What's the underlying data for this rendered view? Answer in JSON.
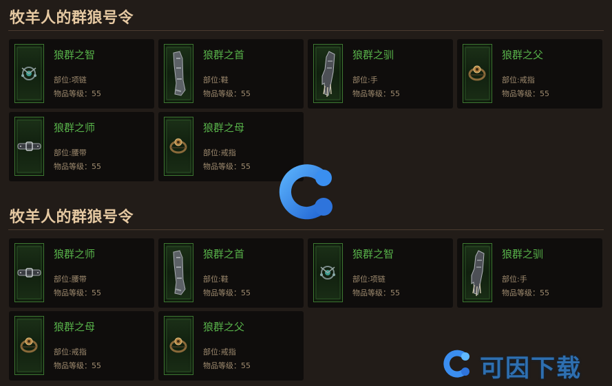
{
  "sections": [
    {
      "title": "牧羊人的群狼号令",
      "items": [
        {
          "name": "狼群之智",
          "slot": "部位:项链",
          "level": "物品等级：55",
          "icon": "amulet-icon"
        },
        {
          "name": "狼群之首",
          "slot": "部位:鞋",
          "level": "物品等级：55",
          "icon": "boots-icon"
        },
        {
          "name": "狼群之驯",
          "slot": "部位:手",
          "level": "物品等级：55",
          "icon": "gloves-icon"
        },
        {
          "name": "狼群之父",
          "slot": "部位:戒指",
          "level": "物品等级：55",
          "icon": "ring-icon"
        },
        {
          "name": "狼群之师",
          "slot": "部位:腰带",
          "level": "物品等级：55",
          "icon": "belt-icon"
        },
        {
          "name": "狼群之母",
          "slot": "部位:戒指",
          "level": "物品等级：55",
          "icon": "ring-icon"
        }
      ]
    },
    {
      "title": "牧羊人的群狼号令",
      "items": [
        {
          "name": "狼群之师",
          "slot": "部位:腰带",
          "level": "物品等级：55",
          "icon": "belt-icon"
        },
        {
          "name": "狼群之首",
          "slot": "部位:鞋",
          "level": "物品等级：55",
          "icon": "boots-icon"
        },
        {
          "name": "狼群之智",
          "slot": "部位:项链",
          "level": "物品等级：55",
          "icon": "amulet-icon"
        },
        {
          "name": "狼群之驯",
          "slot": "部位:手",
          "level": "物品等级：55",
          "icon": "gloves-icon"
        },
        {
          "name": "狼群之母",
          "slot": "部位:戒指",
          "level": "物品等级：55",
          "icon": "ring-icon"
        },
        {
          "name": "狼群之父",
          "slot": "部位:戒指",
          "level": "物品等级：55",
          "icon": "ring-icon"
        }
      ]
    }
  ],
  "watermark": {
    "text": "可因下载"
  },
  "colors": {
    "item_name": "#58b34a",
    "section_title": "#e6c9a2",
    "meta_text": "#a08c70"
  }
}
